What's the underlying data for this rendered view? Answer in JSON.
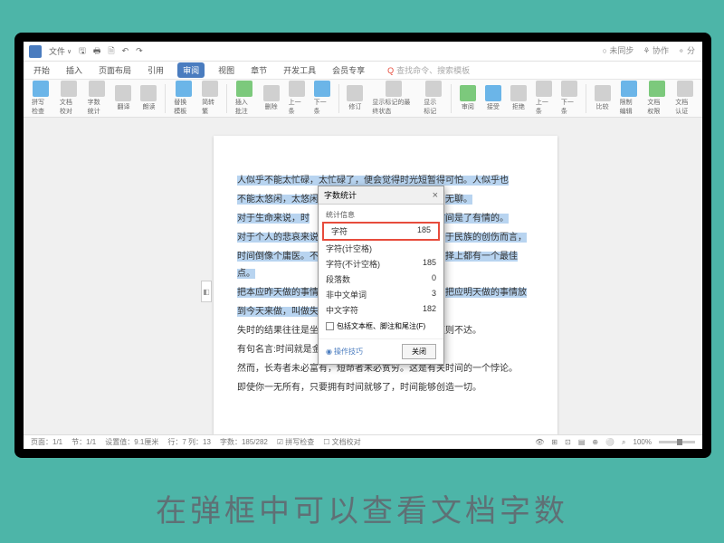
{
  "titlebar": {
    "filesLabel": "文件",
    "arrow": "∨"
  },
  "rightControls": {
    "sync": "○ 未同步",
    "collab": "⚘ 协作",
    "share": "⚬ 分"
  },
  "tabs": {
    "items": [
      "开始",
      "插入",
      "页面布局",
      "引用",
      "审阅",
      "视图",
      "章节",
      "开发工具",
      "会员专享"
    ],
    "activeIndex": 4,
    "searchIcon": "Q",
    "searchText": "查找命令、搜索模板"
  },
  "toolbar": {
    "items": [
      {
        "label": "拼写检查"
      },
      {
        "label": "文档校对"
      },
      {
        "label": "字数统计"
      },
      {
        "label": "翻译"
      },
      {
        "label": "朗读"
      },
      {
        "label": "替换模板"
      },
      {
        "label": "简转繁"
      },
      {
        "label": "插入批注"
      },
      {
        "label": "删除"
      },
      {
        "label": "上一条"
      },
      {
        "label": "下一条"
      },
      {
        "label": "修订"
      },
      {
        "label": "显示标记的最终状态"
      },
      {
        "label": "显示标记"
      },
      {
        "label": "审阅"
      },
      {
        "label": "接受"
      },
      {
        "label": "拒绝"
      },
      {
        "label": "上一条"
      },
      {
        "label": "下一条"
      },
      {
        "label": "比较"
      },
      {
        "label": "限制编辑"
      },
      {
        "label": "文档权限"
      },
      {
        "label": "文档认证"
      }
    ]
  },
  "document": {
    "lines": [
      {
        "sel": true,
        "text": "人似乎不能太忙碌，太忙碌了，便会觉得时光短暂得可怕。人似乎也"
      },
      {
        "sel": true,
        "text": "不能太悠闲，太悠闲",
        "tail": "无聊。"
      },
      {
        "sel": true,
        "text": "对于生命来说，时",
        "tail": "时间是了有情的。"
      },
      {
        "sel": true,
        "text": "对于个人的悲哀来说",
        "tail": "于民族的创伤而言，"
      },
      {
        "sel": true,
        "text": "时间倒像个庸医。不",
        "tail": "择上都有一个最佳点。"
      },
      {
        "sel": true,
        "text": "把本应昨天做的事情",
        "tail": "把应明天做的事情放"
      },
      {
        "sel": true,
        "text": "到今天来做，叫做失"
      },
      {
        "sel": false,
        "text": "失时的结果往往是坐失良机，失察的结果常常是欲速则不达。"
      },
      {
        "sel": false,
        "text": "有句名言:时间就是金钱。"
      },
      {
        "sel": false,
        "text": "然而，长寿者未必富有，短命者未必贫穷。这是有关时间的一个悖论。"
      },
      {
        "sel": false,
        "text": "即使你一无所有，只要拥有时间就够了，时间能够创造一切。"
      }
    ]
  },
  "dialog": {
    "title": "字数统计",
    "section": "统计信息",
    "rows": [
      {
        "label": "字符",
        "value": "185",
        "hl": true
      },
      {
        "label": "字符(计空格)",
        "value": ""
      },
      {
        "label": "字符(不计空格)",
        "value": "185"
      },
      {
        "label": "段落数",
        "value": "0"
      },
      {
        "label": "非中文单词",
        "value": "3"
      },
      {
        "label": "中文字符",
        "value": "182"
      }
    ],
    "checkbox": "包括文本框、脚注和尾注(F)",
    "tipIcon": "◉",
    "tip": "操作技巧",
    "close": "关闭"
  },
  "statusbar": {
    "items": [
      "页面：1/1",
      "节：1/1",
      "设置值：9.1厘米",
      "行：7  列：13",
      "字数：185/282",
      "☑ 拼写检查",
      "☐ 文档校对"
    ],
    "rightItems": [
      "👁",
      "⊞",
      "⊡",
      "▤",
      "⊕",
      "⚪"
    ],
    "zoom": "100%"
  },
  "caption": "在弹框中可以查看文档字数"
}
